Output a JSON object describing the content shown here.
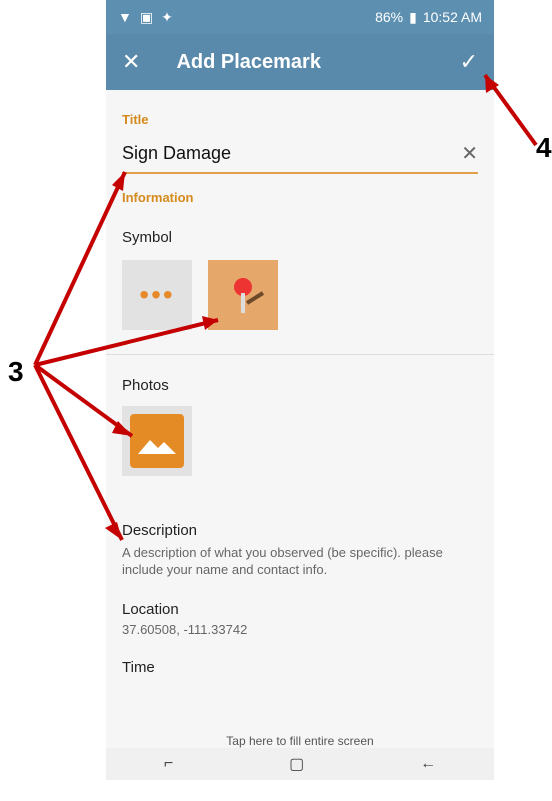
{
  "status": {
    "time": "10:52 AM",
    "battery": "86%"
  },
  "header": {
    "title": "Add Placemark"
  },
  "title_section": {
    "label": "Title",
    "value": "Sign Damage"
  },
  "info": {
    "label": "Information"
  },
  "symbol": {
    "label": "Symbol"
  },
  "photos": {
    "label": "Photos"
  },
  "description": {
    "label": "Description",
    "placeholder": "A description of what you observed (be specific). please include your name and contact info."
  },
  "location": {
    "label": "Location",
    "value": "37.60508, -111.33742"
  },
  "time": {
    "label": "Time"
  },
  "hint": {
    "text": "Tap here to fill entire screen"
  },
  "annotations": {
    "label3": "3",
    "label4": "4"
  }
}
